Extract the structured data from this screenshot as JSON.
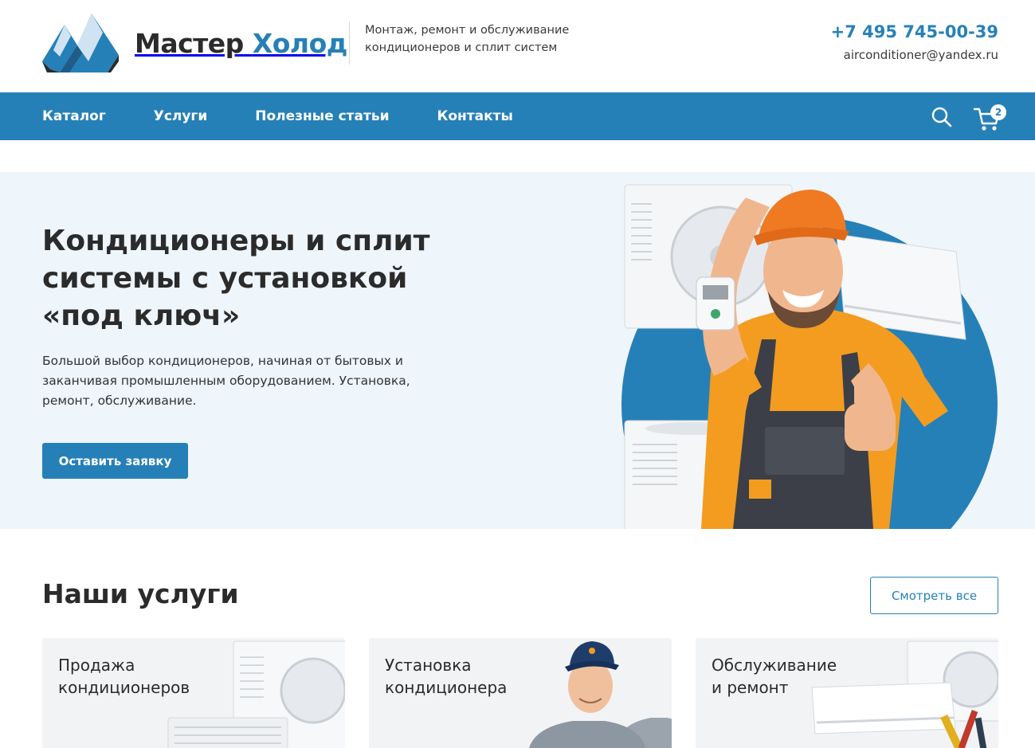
{
  "header": {
    "logo": {
      "name_part1": "Мастер",
      "name_part2": "Холод"
    },
    "tagline": {
      "line1": "Монтаж, ремонт и обслуживание",
      "line2": "кондиционеров и сплит систем"
    },
    "phone": "+7 495 745-00-39",
    "email": "airconditioner@yandex.ru"
  },
  "nav": {
    "items": [
      {
        "label": "Каталог"
      },
      {
        "label": "Услуги"
      },
      {
        "label": "Полезные статьи"
      },
      {
        "label": "Контакты"
      }
    ],
    "search_icon": "search-icon",
    "cart_icon": "cart-icon",
    "cart_count": "2"
  },
  "hero": {
    "title_line1": "Кондиционеры и сплит",
    "title_line2": "системы с установкой",
    "title_line3": "«под ключ»",
    "description": "Большой выбор кондиционеров, начиная от бытовых и заканчивая промышленным оборудованием. Установка, ремонт, обслуживание.",
    "button_label": "Оставить заявку"
  },
  "services": {
    "title": "Наши услуги",
    "see_all_label": "Смотреть все",
    "cards": [
      {
        "line1": "Продажа",
        "line2": "кондиционеров"
      },
      {
        "line1": "Установка",
        "line2": "кондиционера"
      },
      {
        "line1": "Обслуживание",
        "line2": "и ремонт"
      }
    ]
  },
  "colors": {
    "brand_blue": "#2680b8",
    "dark_text": "#2b2b2b",
    "hero_bg": "#eef5fb",
    "card_bg": "#f2f3f5",
    "worker_shirt": "#f39c1f"
  }
}
